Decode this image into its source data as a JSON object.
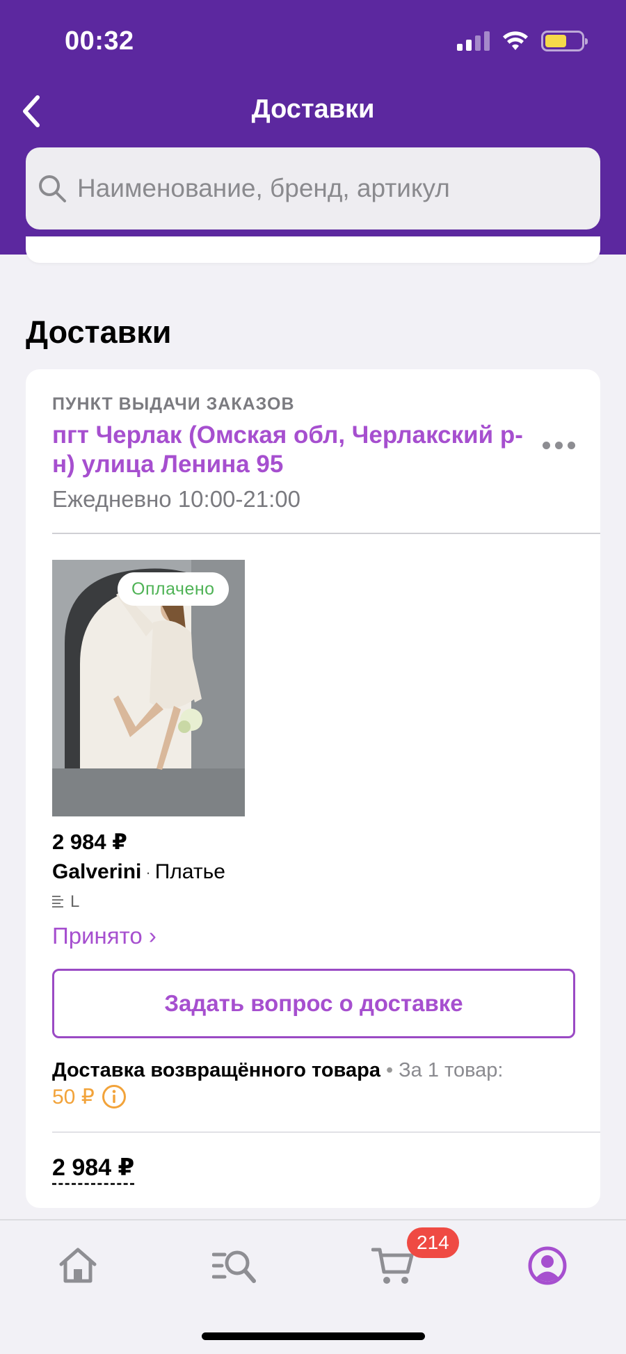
{
  "status_bar": {
    "time": "00:32"
  },
  "nav": {
    "title": "Доставки"
  },
  "search": {
    "placeholder": "Наименование, бренд, артикул"
  },
  "section": {
    "title": "Доставки"
  },
  "delivery": {
    "pickup_label": "ПУНКТ ВЫДАЧИ ЗАКАЗОВ",
    "address": "пгт Черлак (Омская обл, Черлакский р-н) улица Ленина 95",
    "hours": "Ежедневно 10:00-21:00",
    "item": {
      "badge": "Оплачено",
      "price": "2 984 ₽",
      "brand": "Galverini",
      "separator": "·",
      "name": "Платье",
      "size": "L",
      "status": "Принято ›"
    },
    "ask_button": "Задать вопрос о доставке",
    "return": {
      "label": "Доставка возвращённого товара",
      "separator": "•",
      "per_item": "За 1 товар:",
      "fee": "50 ₽"
    },
    "total": "2 984 ₽"
  },
  "tabbar": {
    "items": [
      "home-icon",
      "catalog-search-icon",
      "cart-icon",
      "profile-icon"
    ],
    "cart_count": "214",
    "active": "profile"
  },
  "colors": {
    "header": "#5c289f",
    "accent": "#a64fcf",
    "paid": "#4fb356",
    "fee": "#f2a33a",
    "badge": "#ef4a43"
  }
}
